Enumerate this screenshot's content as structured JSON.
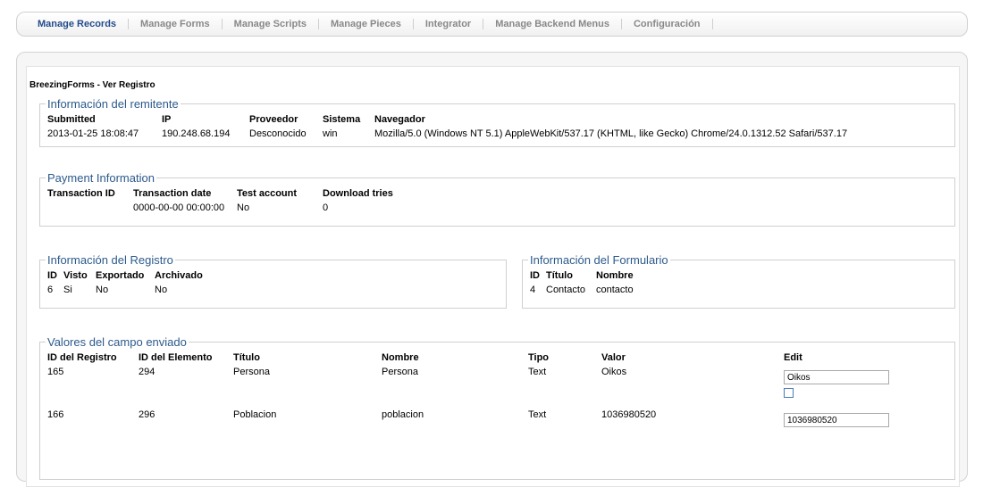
{
  "tabs": [
    "Manage Records",
    "Manage Forms",
    "Manage Scripts",
    "Manage Pieces",
    "Integrator",
    "Manage Backend Menus",
    "Configuración"
  ],
  "page_title": "BreezingForms - Ver Registro",
  "sender": {
    "legend": "Información del remitente",
    "headers": [
      "Submitted",
      "IP",
      "Proveedor",
      "Sistema",
      "Navegador"
    ],
    "row": [
      "2013-01-25 18:08:47",
      "190.248.68.194",
      "Desconocido",
      "win",
      "Mozilla/5.0 (Windows NT 5.1) AppleWebKit/537.17 (KHTML, like Gecko) Chrome/24.0.1312.52 Safari/537.17"
    ]
  },
  "payment": {
    "legend": "Payment Information",
    "headers": [
      "Transaction ID",
      "Transaction date",
      "Test account",
      "Download tries"
    ],
    "row": [
      "",
      "0000-00-00 00:00:00",
      "No",
      "0"
    ]
  },
  "record": {
    "legend": "Información del Registro",
    "headers": [
      "ID",
      "Visto",
      "Exportado",
      "Archivado"
    ],
    "row": [
      "6",
      "Si",
      "No",
      "No"
    ]
  },
  "form": {
    "legend": "Información del Formulario",
    "headers": [
      "ID",
      "Título",
      "Nombre"
    ],
    "row": [
      "4",
      "Contacto",
      "contacto"
    ]
  },
  "values": {
    "legend": "Valores del campo enviado",
    "headers": [
      "ID del Registro",
      "ID del Elemento",
      "Título",
      "Nombre",
      "Tipo",
      "Valor",
      "Edit"
    ],
    "rows": [
      {
        "reg": "165",
        "el": "294",
        "title": "Persona",
        "name": "Persona",
        "type": "Text",
        "value": "Oikos",
        "edit": "Oikos"
      },
      {
        "reg": "166",
        "el": "296",
        "title": "Poblacion",
        "name": "poblacion",
        "type": "Text",
        "value": "1036980520",
        "edit": "1036980520"
      }
    ]
  }
}
